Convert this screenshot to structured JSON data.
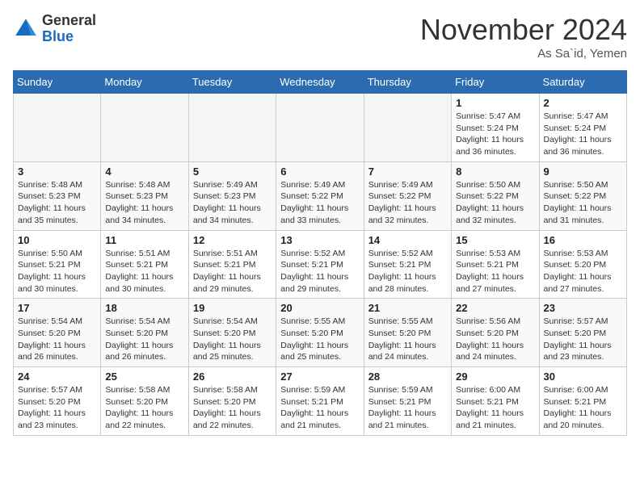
{
  "header": {
    "logo_general": "General",
    "logo_blue": "Blue",
    "month_title": "November 2024",
    "location": "As Sa`id, Yemen"
  },
  "days_of_week": [
    "Sunday",
    "Monday",
    "Tuesday",
    "Wednesday",
    "Thursday",
    "Friday",
    "Saturday"
  ],
  "weeks": [
    [
      {
        "day": "",
        "info": ""
      },
      {
        "day": "",
        "info": ""
      },
      {
        "day": "",
        "info": ""
      },
      {
        "day": "",
        "info": ""
      },
      {
        "day": "",
        "info": ""
      },
      {
        "day": "1",
        "info": "Sunrise: 5:47 AM\nSunset: 5:24 PM\nDaylight: 11 hours and 36 minutes."
      },
      {
        "day": "2",
        "info": "Sunrise: 5:47 AM\nSunset: 5:24 PM\nDaylight: 11 hours and 36 minutes."
      }
    ],
    [
      {
        "day": "3",
        "info": "Sunrise: 5:48 AM\nSunset: 5:23 PM\nDaylight: 11 hours and 35 minutes."
      },
      {
        "day": "4",
        "info": "Sunrise: 5:48 AM\nSunset: 5:23 PM\nDaylight: 11 hours and 34 minutes."
      },
      {
        "day": "5",
        "info": "Sunrise: 5:49 AM\nSunset: 5:23 PM\nDaylight: 11 hours and 34 minutes."
      },
      {
        "day": "6",
        "info": "Sunrise: 5:49 AM\nSunset: 5:22 PM\nDaylight: 11 hours and 33 minutes."
      },
      {
        "day": "7",
        "info": "Sunrise: 5:49 AM\nSunset: 5:22 PM\nDaylight: 11 hours and 32 minutes."
      },
      {
        "day": "8",
        "info": "Sunrise: 5:50 AM\nSunset: 5:22 PM\nDaylight: 11 hours and 32 minutes."
      },
      {
        "day": "9",
        "info": "Sunrise: 5:50 AM\nSunset: 5:22 PM\nDaylight: 11 hours and 31 minutes."
      }
    ],
    [
      {
        "day": "10",
        "info": "Sunrise: 5:50 AM\nSunset: 5:21 PM\nDaylight: 11 hours and 30 minutes."
      },
      {
        "day": "11",
        "info": "Sunrise: 5:51 AM\nSunset: 5:21 PM\nDaylight: 11 hours and 30 minutes."
      },
      {
        "day": "12",
        "info": "Sunrise: 5:51 AM\nSunset: 5:21 PM\nDaylight: 11 hours and 29 minutes."
      },
      {
        "day": "13",
        "info": "Sunrise: 5:52 AM\nSunset: 5:21 PM\nDaylight: 11 hours and 29 minutes."
      },
      {
        "day": "14",
        "info": "Sunrise: 5:52 AM\nSunset: 5:21 PM\nDaylight: 11 hours and 28 minutes."
      },
      {
        "day": "15",
        "info": "Sunrise: 5:53 AM\nSunset: 5:21 PM\nDaylight: 11 hours and 27 minutes."
      },
      {
        "day": "16",
        "info": "Sunrise: 5:53 AM\nSunset: 5:20 PM\nDaylight: 11 hours and 27 minutes."
      }
    ],
    [
      {
        "day": "17",
        "info": "Sunrise: 5:54 AM\nSunset: 5:20 PM\nDaylight: 11 hours and 26 minutes."
      },
      {
        "day": "18",
        "info": "Sunrise: 5:54 AM\nSunset: 5:20 PM\nDaylight: 11 hours and 26 minutes."
      },
      {
        "day": "19",
        "info": "Sunrise: 5:54 AM\nSunset: 5:20 PM\nDaylight: 11 hours and 25 minutes."
      },
      {
        "day": "20",
        "info": "Sunrise: 5:55 AM\nSunset: 5:20 PM\nDaylight: 11 hours and 25 minutes."
      },
      {
        "day": "21",
        "info": "Sunrise: 5:55 AM\nSunset: 5:20 PM\nDaylight: 11 hours and 24 minutes."
      },
      {
        "day": "22",
        "info": "Sunrise: 5:56 AM\nSunset: 5:20 PM\nDaylight: 11 hours and 24 minutes."
      },
      {
        "day": "23",
        "info": "Sunrise: 5:57 AM\nSunset: 5:20 PM\nDaylight: 11 hours and 23 minutes."
      }
    ],
    [
      {
        "day": "24",
        "info": "Sunrise: 5:57 AM\nSunset: 5:20 PM\nDaylight: 11 hours and 23 minutes."
      },
      {
        "day": "25",
        "info": "Sunrise: 5:58 AM\nSunset: 5:20 PM\nDaylight: 11 hours and 22 minutes."
      },
      {
        "day": "26",
        "info": "Sunrise: 5:58 AM\nSunset: 5:20 PM\nDaylight: 11 hours and 22 minutes."
      },
      {
        "day": "27",
        "info": "Sunrise: 5:59 AM\nSunset: 5:21 PM\nDaylight: 11 hours and 21 minutes."
      },
      {
        "day": "28",
        "info": "Sunrise: 5:59 AM\nSunset: 5:21 PM\nDaylight: 11 hours and 21 minutes."
      },
      {
        "day": "29",
        "info": "Sunrise: 6:00 AM\nSunset: 5:21 PM\nDaylight: 11 hours and 21 minutes."
      },
      {
        "day": "30",
        "info": "Sunrise: 6:00 AM\nSunset: 5:21 PM\nDaylight: 11 hours and 20 minutes."
      }
    ]
  ]
}
